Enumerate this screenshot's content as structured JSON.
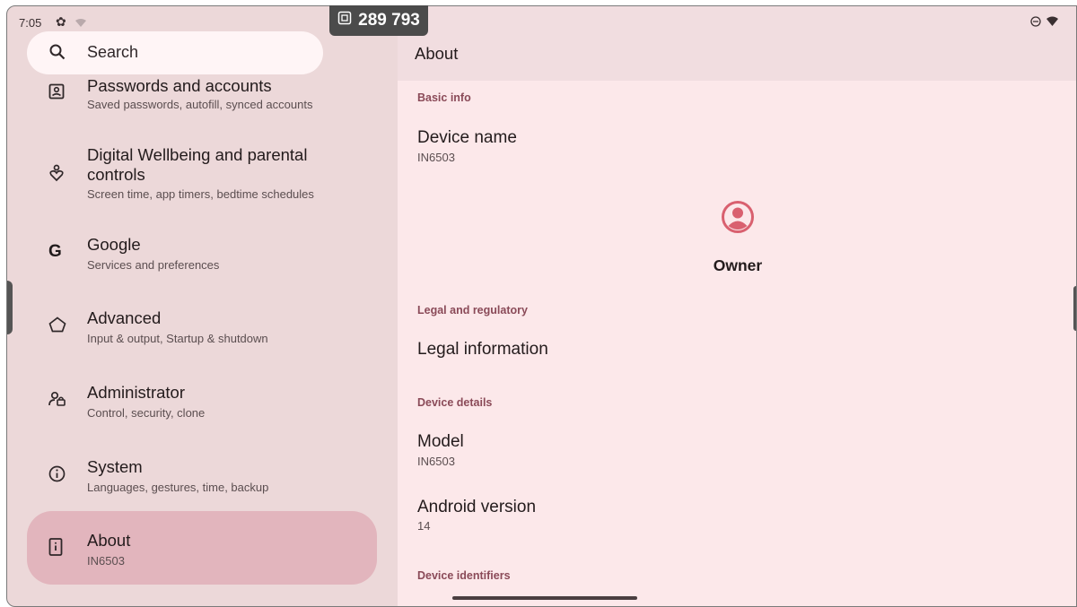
{
  "status": {
    "time": "7:05"
  },
  "overlay": {
    "counter": "289 793"
  },
  "search": {
    "placeholder": "Search"
  },
  "settings_items": [
    {
      "title": "Passwords and accounts",
      "subtitle": "Saved passwords, autofill, synced accounts",
      "icon": "account-box-icon"
    },
    {
      "title": "Digital Wellbeing and parental controls",
      "subtitle": "Screen time, app timers, bedtime schedules",
      "icon": "wellbeing-icon"
    },
    {
      "title": "Google",
      "subtitle": "Services and preferences",
      "icon": "google-icon"
    },
    {
      "title": "Advanced",
      "subtitle": "Input & output, Startup & shutdown",
      "icon": "advanced-icon"
    },
    {
      "title": "Administrator",
      "subtitle": "Control, security, clone",
      "icon": "admin-icon"
    },
    {
      "title": "System",
      "subtitle": "Languages, gestures, time, backup",
      "icon": "info-icon"
    },
    {
      "title": "About",
      "subtitle": "IN6503",
      "icon": "device-info-icon",
      "selected": true
    }
  ],
  "about": {
    "header": "About",
    "sections": {
      "basic_info": "Basic info",
      "legal": "Legal and regulatory",
      "device_details": "Device details",
      "device_identifiers": "Device identifiers"
    },
    "device_name": {
      "title": "Device name",
      "value": "IN6503"
    },
    "owner": "Owner",
    "legal_information": "Legal information",
    "model": {
      "title": "Model",
      "value": "IN6503"
    },
    "android_version": {
      "title": "Android version",
      "value": "14"
    }
  },
  "colors": {
    "left_bg": "#ecd8d9",
    "right_bg": "#fce8ea",
    "selected_item": "#e2b5bd",
    "section_header": "#8a4a58",
    "owner_icon": "#d9606f"
  }
}
